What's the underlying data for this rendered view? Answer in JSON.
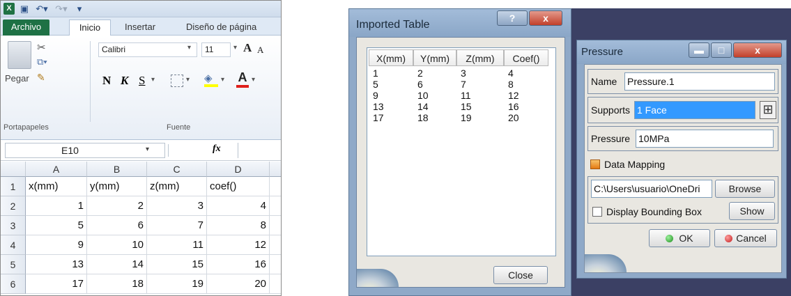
{
  "excel": {
    "menu_tabs": [
      "Archivo",
      "Inicio",
      "Insertar",
      "Diseño de página"
    ],
    "clipboard": {
      "paste_label": "Pegar",
      "group_label": "Portapapeles"
    },
    "font": {
      "name": "Calibri",
      "size": "11",
      "group_label": "Fuente",
      "bold": "N",
      "italic": "K",
      "underline": "S",
      "grow": "A",
      "shrink": "A"
    },
    "name_box": "E10",
    "formula_symbol": "fx",
    "columns": [
      "A",
      "B",
      "C",
      "D"
    ],
    "rows": [
      {
        "n": "1",
        "cells": [
          "x(mm)",
          "y(mm)",
          "z(mm)",
          "coef()"
        ]
      },
      {
        "n": "2",
        "cells": [
          "1",
          "2",
          "3",
          "4"
        ]
      },
      {
        "n": "3",
        "cells": [
          "5",
          "6",
          "7",
          "8"
        ]
      },
      {
        "n": "4",
        "cells": [
          "9",
          "10",
          "11",
          "12"
        ]
      },
      {
        "n": "5",
        "cells": [
          "13",
          "14",
          "15",
          "16"
        ]
      },
      {
        "n": "6",
        "cells": [
          "17",
          "18",
          "19",
          "20"
        ]
      }
    ]
  },
  "imported": {
    "title": "Imported Table",
    "help_button": "?",
    "close_x": "x",
    "headers": [
      "X(mm)",
      "Y(mm)",
      "Z(mm)",
      "Coef()"
    ],
    "rows": [
      [
        "1",
        "2",
        "3",
        "4"
      ],
      [
        "5",
        "6",
        "7",
        "8"
      ],
      [
        "9",
        "10",
        "11",
        "12"
      ],
      [
        "13",
        "14",
        "15",
        "16"
      ],
      [
        "17",
        "18",
        "19",
        "20"
      ]
    ],
    "close_label": "Close"
  },
  "pressure": {
    "title": "Pressure",
    "close_x": "x",
    "name_label": "Name",
    "name_value": "Pressure.1",
    "supports_label": "Supports",
    "supports_value": "1 Face",
    "pressure_label": "Pressure",
    "pressure_value": "10MPa",
    "data_mapping_label": "Data Mapping",
    "path_value": "C:\\Users\\usuario\\OneDri",
    "browse_label": "Browse",
    "display_bb_label": "Display Bounding Box",
    "show_label": "Show",
    "ok_label": "OK",
    "cancel_label": "Cancel"
  }
}
